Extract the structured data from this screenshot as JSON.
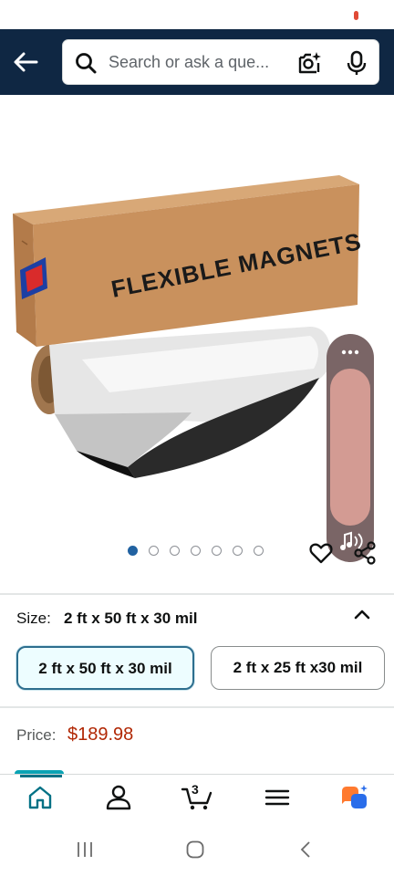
{
  "header": {
    "search_placeholder": "Search or ask a que..."
  },
  "gallery": {
    "image_count": 7,
    "active_index": 0,
    "product_box_text": "FLEXIBLE MAGNETS"
  },
  "size": {
    "label": "Size:",
    "selected": "2 ft x 50 ft x 30 mil",
    "options": [
      "2 ft x 50 ft x 30 mil",
      "2 ft x 25 ft x30 mil"
    ]
  },
  "price": {
    "label": "Price:",
    "value": "$189.98"
  },
  "bottom_nav": {
    "cart_count": "3",
    "items": [
      "home-icon",
      "account-icon",
      "cart-icon",
      "menu-icon",
      "rufus-icon"
    ]
  },
  "colors": {
    "header_bg": "#0f2743",
    "price": "#b12704",
    "active_dot": "#2162a1",
    "selected_border": "#2d6e8e"
  }
}
